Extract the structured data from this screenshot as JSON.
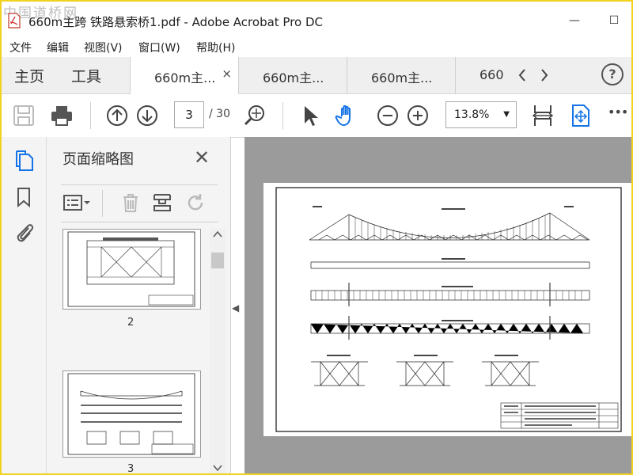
{
  "window": {
    "title": "660m主跨 铁路悬索桥1.pdf - Adobe Acrobat Pro DC",
    "minimize": "—",
    "maximize": "☐",
    "watermark": "中国道桥网"
  },
  "menu": {
    "items": [
      "文件",
      "编辑",
      "视图(V)",
      "窗口(W)",
      "帮助(H)"
    ]
  },
  "tabs": {
    "home": "主页",
    "tools": "工具",
    "documents": [
      "660m主...",
      "660m主...",
      "660m主...",
      "660"
    ],
    "close": "×",
    "prev": "‹",
    "next": "›",
    "help": "?"
  },
  "toolbar": {
    "page_current": "3",
    "page_total": "/ 30",
    "zoom": "13.8%",
    "zoom_caret": "▼",
    "more": "•••",
    "accent": "#1473e6"
  },
  "panel": {
    "title": "页面缩略图",
    "close": "✕",
    "thumbs": [
      {
        "label": "2"
      },
      {
        "label": "3"
      }
    ]
  },
  "collapse_arrow": "◀",
  "icons": [
    "save-icon",
    "print-icon",
    "page-up-icon",
    "page-down-icon",
    "zoom-icon",
    "select-arrow-icon",
    "hand-icon",
    "zoom-out-icon",
    "zoom-in-icon",
    "fit-page-icon",
    "scroll-mode-icon",
    "pages-icon",
    "bookmark-icon",
    "attachment-icon",
    "delete-icon",
    "extract-icon",
    "rotate-icon"
  ]
}
